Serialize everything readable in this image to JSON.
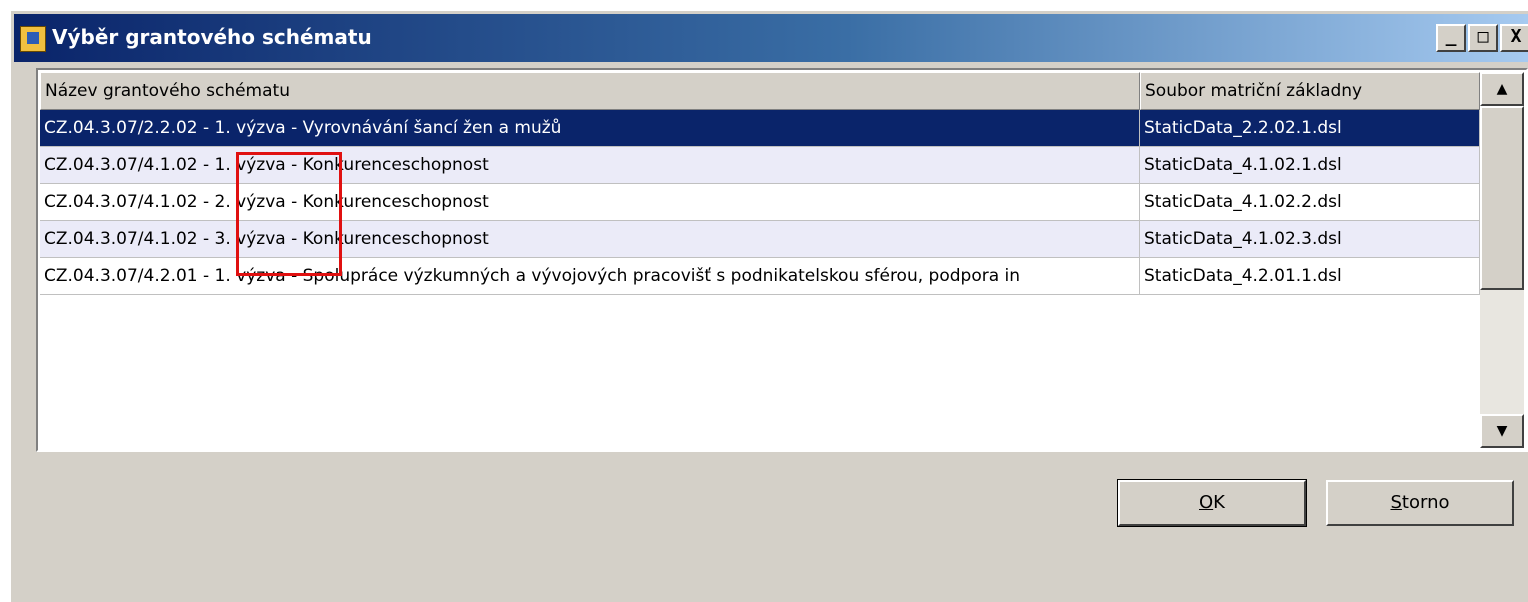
{
  "window": {
    "title": "Výběr grantového schématu",
    "icon": "app-icon",
    "controls": {
      "minimize_label": "_",
      "maximize_label": "□",
      "close_label": "X"
    }
  },
  "table": {
    "columns": [
      "Název grantového schématu",
      "Soubor matriční základny"
    ],
    "rows": [
      {
        "name": "CZ.04.3.07/2.2.02 - 1. výzva - Vyrovnávání šancí žen a mužů",
        "file": "StaticData_2.2.02.1.dsl",
        "selected": true
      },
      {
        "name": "CZ.04.3.07/4.1.02 - 1. výzva - Konkurenceschopnost",
        "file": "StaticData_4.1.02.1.dsl"
      },
      {
        "name": "CZ.04.3.07/4.1.02 - 2. výzva - Konkurenceschopnost",
        "file": "StaticData_4.1.02.2.dsl"
      },
      {
        "name": "CZ.04.3.07/4.1.02 - 3. výzva - Konkurenceschopnost",
        "file": "StaticData_4.1.02.3.dsl"
      },
      {
        "name": "CZ.04.3.07/4.2.01 - 1. výzva - Spolupráce výzkumných a vývojových pracovišť s podnikatelskou sférou, podpora in",
        "file": "StaticData_4.2.01.1.dsl"
      }
    ]
  },
  "scrollbar": {
    "up_icon": "▲",
    "down_icon": "▼"
  },
  "buttons": {
    "ok": {
      "mnemonic": "O",
      "rest": "K"
    },
    "storno": {
      "mnemonic": "S",
      "rest": "torno"
    }
  },
  "colors": {
    "title_gradient_start": "#0a246a",
    "title_gradient_end": "#a6caf0",
    "selection": "#0a246a",
    "highlight_box": "#e01010"
  }
}
